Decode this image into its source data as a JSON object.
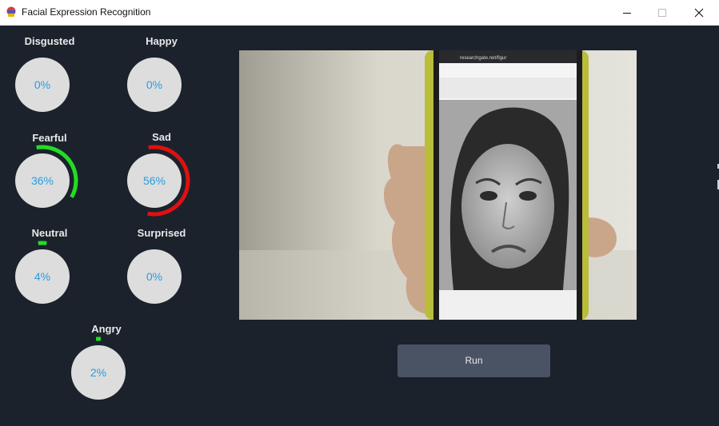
{
  "window": {
    "title": "Facial Expression Recognition"
  },
  "emotions": [
    {
      "id": "disgusted",
      "label": "Disgusted",
      "value": "0%",
      "fraction": 0.0,
      "color": "#22dd22"
    },
    {
      "id": "happy",
      "label": "Happy",
      "value": "0%",
      "fraction": 0.0,
      "color": "#22dd22"
    },
    {
      "id": "fearful",
      "label": "Fearful",
      "value": "36%",
      "fraction": 0.36,
      "color": "#22dd22"
    },
    {
      "id": "sad",
      "label": "Sad",
      "value": "56%",
      "fraction": 0.56,
      "color": "#e01010"
    },
    {
      "id": "neutral",
      "label": "Neutral",
      "value": "4%",
      "fraction": 0.04,
      "color": "#22dd22"
    },
    {
      "id": "surprised",
      "label": "Surprised",
      "value": "0%",
      "fraction": 0.0,
      "color": "#22dd22"
    },
    {
      "id": "angry",
      "label": "Angry",
      "value": "2%",
      "fraction": 0.02,
      "color": "#22dd22"
    }
  ],
  "camera": {
    "phone_url": "researchgate.net/figur"
  },
  "run_button": {
    "label": "Run"
  },
  "colors": {
    "background": "#1b222c",
    "gauge_fill": "#dddddd",
    "value_text": "#2d9cdb",
    "button": "#4a5363"
  }
}
